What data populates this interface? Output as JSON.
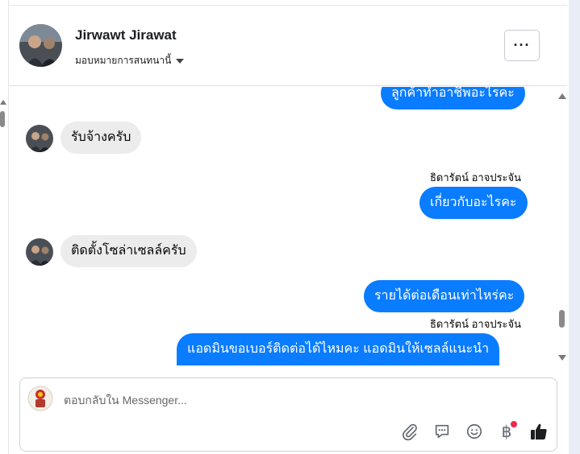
{
  "header": {
    "contact_name": "Jirwawt Jirawat",
    "assign_label": "มอบหมายการสนทนานี้",
    "more_label": "···"
  },
  "messages": [
    {
      "direction": "out",
      "text": "ลูกค้าทำอาชีพอะไรคะ"
    },
    {
      "direction": "in",
      "text": "รับจ้างครับ"
    },
    {
      "direction": "out",
      "sender": "ธิดารัตน์ อาจประจัน",
      "text": "เกี่ยวกับอะไรคะ"
    },
    {
      "direction": "in",
      "text": "ติดตั้งโซล่าเซลล์ครับ"
    },
    {
      "direction": "out",
      "text": "รายได้ต่อเดือนเท่าไหร่คะ"
    },
    {
      "direction": "out",
      "sender": "ธิดารัตน์ อาจประจัน",
      "text": "แอดมินขอเบอร์ติดต่อได้ไหมคะ แอดมินให้เซลล์แนะนำ"
    }
  ],
  "composer": {
    "placeholder": "ตอบกลับใน Messenger..."
  },
  "tools": [
    "paperclip-icon",
    "saved-reply-icon",
    "emoji-icon",
    "payment-icon",
    "like-icon"
  ],
  "colors": {
    "outgoing_bubble": "#0a7cff",
    "incoming_bubble": "#ececec",
    "notification_dot": "#f02849"
  }
}
